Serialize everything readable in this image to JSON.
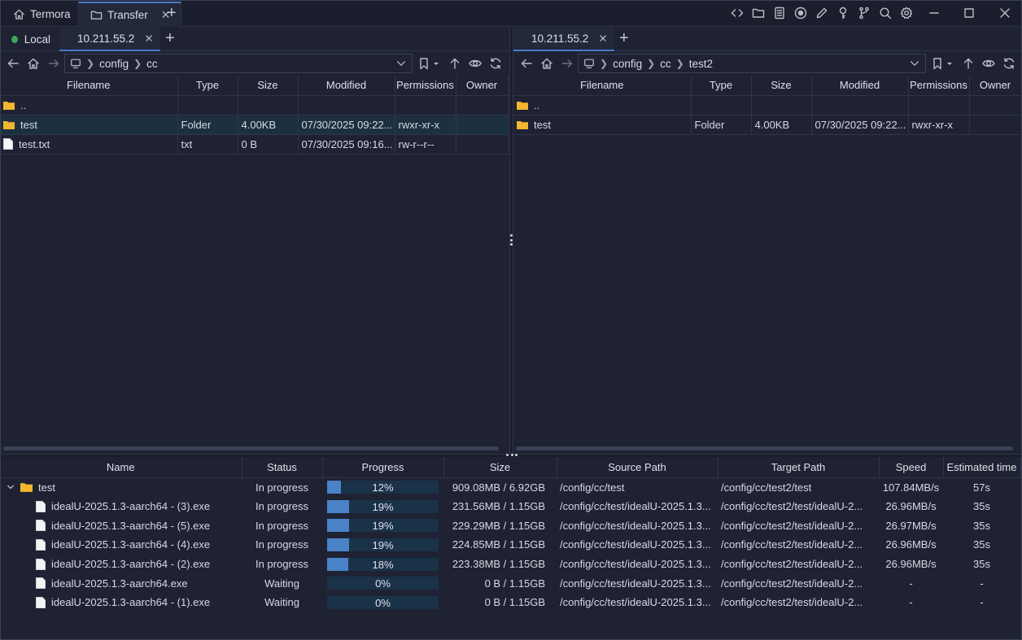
{
  "app_tabs": [
    {
      "label": "Termora",
      "icon": "home-icon"
    },
    {
      "label": "Transfer",
      "icon": "folder-icon"
    }
  ],
  "left_pane": {
    "tabs": [
      {
        "label": "Local"
      },
      {
        "label": "10.211.55.2"
      }
    ],
    "path": [
      "config",
      "cc"
    ],
    "columns": [
      "Filename",
      "Type",
      "Size",
      "Modified",
      "Permissions",
      "Owner"
    ],
    "rows": [
      {
        "name": "..",
        "type": "",
        "size": "",
        "modified": "",
        "perms": "",
        "owner": "",
        "kind": "folder"
      },
      {
        "name": "test",
        "type": "Folder",
        "size": "4.00KB",
        "modified": "07/30/2025 09:22...",
        "perms": "rwxr-xr-x",
        "owner": "",
        "kind": "folder"
      },
      {
        "name": "test.txt",
        "type": "txt",
        "size": "0 B",
        "modified": "07/30/2025 09:16...",
        "perms": "rw-r--r--",
        "owner": "",
        "kind": "file"
      }
    ]
  },
  "right_pane": {
    "tabs": [
      {
        "label": "10.211.55.2"
      }
    ],
    "path": [
      "config",
      "cc",
      "test2"
    ],
    "columns": [
      "Filename",
      "Type",
      "Size",
      "Modified",
      "Permissions",
      "Owner"
    ],
    "rows": [
      {
        "name": "..",
        "type": "",
        "size": "",
        "modified": "",
        "perms": "",
        "owner": "",
        "kind": "folder"
      },
      {
        "name": "test",
        "type": "Folder",
        "size": "4.00KB",
        "modified": "07/30/2025 09:22...",
        "perms": "rwxr-xr-x",
        "owner": "",
        "kind": "folder"
      }
    ]
  },
  "transfers": {
    "columns": [
      "Name",
      "Status",
      "Progress",
      "Size",
      "Source Path",
      "Target Path",
      "Speed",
      "Estimated time"
    ],
    "rows": [
      {
        "name": "test",
        "status": "In progress",
        "progress": 12,
        "progress_label": "12%",
        "size": "909.08MB / 6.92GB",
        "source": "/config/cc/test",
        "target": "/config/cc/test2/test",
        "speed": "107.84MB/s",
        "eta": "57s",
        "kind": "folder"
      },
      {
        "name": "idealU-2025.1.3-aarch64 - (3).exe",
        "status": "In progress",
        "progress": 19,
        "progress_label": "19%",
        "size": "231.56MB / 1.15GB",
        "source": "/config/cc/test/idealU-2025.1.3...",
        "target": "/config/cc/test2/test/idealU-2...",
        "speed": "26.96MB/s",
        "eta": "35s",
        "kind": "file"
      },
      {
        "name": "idealU-2025.1.3-aarch64 - (5).exe",
        "status": "In progress",
        "progress": 19,
        "progress_label": "19%",
        "size": "229.29MB / 1.15GB",
        "source": "/config/cc/test/idealU-2025.1.3...",
        "target": "/config/cc/test2/test/idealU-2...",
        "speed": "26.97MB/s",
        "eta": "35s",
        "kind": "file"
      },
      {
        "name": "idealU-2025.1.3-aarch64 - (4).exe",
        "status": "In progress",
        "progress": 19,
        "progress_label": "19%",
        "size": "224.85MB / 1.15GB",
        "source": "/config/cc/test/idealU-2025.1.3...",
        "target": "/config/cc/test2/test/idealU-2...",
        "speed": "26.96MB/s",
        "eta": "35s",
        "kind": "file"
      },
      {
        "name": "idealU-2025.1.3-aarch64 - (2).exe",
        "status": "In progress",
        "progress": 18,
        "progress_label": "18%",
        "size": "223.38MB / 1.15GB",
        "source": "/config/cc/test/idealU-2025.1.3...",
        "target": "/config/cc/test2/test/idealU-2...",
        "speed": "26.96MB/s",
        "eta": "35s",
        "kind": "file"
      },
      {
        "name": "idealU-2025.1.3-aarch64.exe",
        "status": "Waiting",
        "progress": 0,
        "progress_label": "0%",
        "size": "0 B / 1.15GB",
        "source": "/config/cc/test/idealU-2025.1.3...",
        "target": "/config/cc/test2/test/idealU-2...",
        "speed": "-",
        "eta": "-",
        "kind": "file"
      },
      {
        "name": "idealU-2025.1.3-aarch64 - (1).exe",
        "status": "Waiting",
        "progress": 0,
        "progress_label": "0%",
        "size": "0 B / 1.15GB",
        "source": "/config/cc/test/idealU-2025.1.3...",
        "target": "/config/cc/test2/test/idealU-2...",
        "speed": "-",
        "eta": "-",
        "kind": "file"
      }
    ]
  },
  "toolbar_icons": [
    "code-icon",
    "folder-icon",
    "notes-icon",
    "record-icon",
    "pencil-icon",
    "key-icon",
    "branch-icon",
    "search-icon",
    "settings-icon"
  ],
  "colors": {
    "accent": "#4a79c9",
    "status_dot": "#3aa65a",
    "folder": "#f2b630",
    "progress_fill": "#4a82c8",
    "selected_row": "#1c3040"
  }
}
